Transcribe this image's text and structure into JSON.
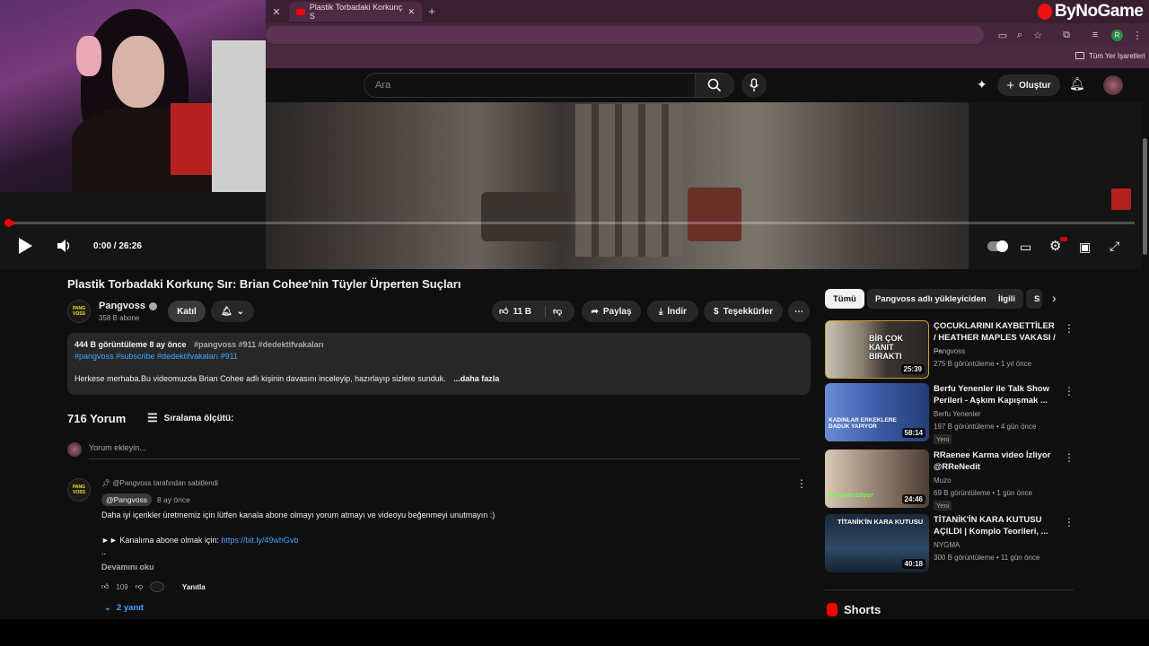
{
  "browser": {
    "tab_title": "Plastik Torbadaki Korkunç S",
    "new_tab": "+",
    "bookmarks_label": "Tüm Yer İşaretleri",
    "overlay_watermark": "ByNoGame"
  },
  "header": {
    "search_placeholder": "Ara",
    "create_label": "Oluştur"
  },
  "player": {
    "time": "0:00 / 26:26",
    "progress": 0.006
  },
  "video": {
    "title": "Plastik Torbadaki Korkunç Sır: Brian Cohee'nin Tüyler Ürperten Suçları",
    "channel": "Pangvoss",
    "avatar_text": "PANG VOSS",
    "subscribers": "358 B abone",
    "join_label": "Katıl",
    "likes": "11 B",
    "share_label": "Paylaş",
    "download_label": "İndir",
    "thanks_label": "Teşekkürler"
  },
  "description": {
    "meta": "444 B görüntüleme  8 ay önce",
    "tags1": "#pangvoss #911 #dedektifvakaları",
    "tags2": "#pangvoss  #subscribe #dedektifvakaları #911",
    "text": "Herkese merhaba.Bu videomuzda Brian Cohee adlı kişinin davasını inceleyip, hazırlayıp sizlere sunduk.",
    "more": "...daha fazla"
  },
  "comments": {
    "count": "716 Yorum",
    "sort_label": "Sıralama ölçütü:",
    "add_placeholder": "Yorum ekleyin...",
    "pinned_by": "@Pangvoss tarafından sabitlendi",
    "author": "@Pangvoss",
    "time": "8 ay önce",
    "body1": "Daha iyi içerikler üretmemiz için lütfen kanala abone olmayı yorum atmayı ve videoyu beğenmeyi unutmayın :)",
    "body2_prefix": "►► Kanalıma abone olmak için: ",
    "body2_link": "https://bit.ly/49whGvb",
    "body3": "..",
    "read_more": "Devamını oku",
    "likes": "109",
    "reply_label": "Yanıtla",
    "replies": "2 yanıt"
  },
  "sidebar": {
    "chips": [
      "Tümü",
      "Pangvoss adlı yükleyiciden",
      "İlgili",
      "S"
    ],
    "recommendations": [
      {
        "title": "ÇOCUKLARINI KAYBETTİLER / HEATHER MAPLES VAKASI / ...",
        "channel": "Pangvoss",
        "meta": "275 B görüntüleme  •  1 yıl önce",
        "duration": "25:39",
        "thumb_text": "BİR ÇOK KANIT BIRAKTI",
        "badge": ""
      },
      {
        "title": "Berfu Yenenler ile Talk Show Perileri - Aşkım Kapışmak ...",
        "channel": "Berfu Yenenler",
        "meta": "197 B görüntüleme  •  4 gün önce",
        "duration": "58:14",
        "thumb_text": "KADINLAR ERKEKLERE DADUK YAPIYOR",
        "badge": "Yeni"
      },
      {
        "title": "RRaenee Karma video İzliyor @RReNedit",
        "channel": "Muzo",
        "meta": "69 B görüntüleme  •  1 gün önce",
        "duration": "24:46",
        "thumb_text": "Rraenee İzliyor",
        "badge": "Yeni"
      },
      {
        "title": "TİTANİK'İN KARA KUTUSU AÇILDI | Komplo Teorileri, ...",
        "channel": "NYGMA",
        "meta": "300 B görüntüleme  •  11 gün önce",
        "duration": "40:18",
        "thumb_text": "TİTANİK'İN KARA KUTUSU",
        "badge": ""
      }
    ],
    "shorts_label": "Shorts"
  },
  "colors": {
    "accent_red": "#ff0000",
    "link_blue": "#3ea6ff",
    "browser_tab": "#3a1f30"
  }
}
